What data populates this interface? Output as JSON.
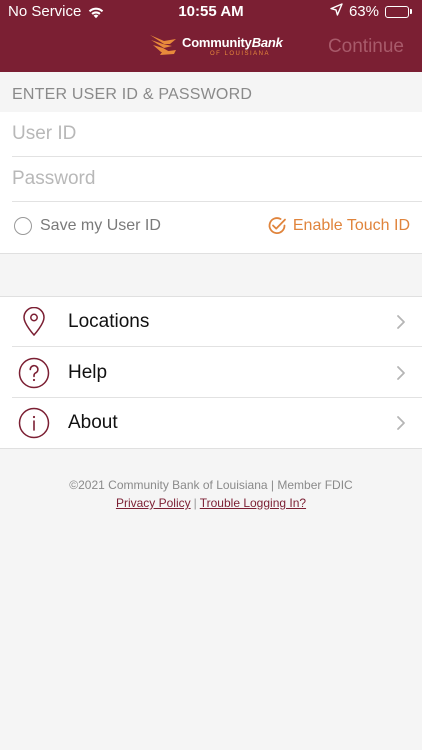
{
  "status_bar": {
    "carrier": "No Service",
    "time": "10:55 AM",
    "battery": "63%",
    "battery_level": 0.63
  },
  "header": {
    "logo": {
      "main_a": "Community",
      "main_b": "Bank",
      "sub": "OF LOUISIANA"
    },
    "continue_label": "Continue"
  },
  "login": {
    "section_label": "ENTER USER ID & PASSWORD",
    "userid_placeholder": "User ID",
    "password_placeholder": "Password",
    "save_userid_label": "Save my User ID",
    "touch_id_label": "Enable Touch ID"
  },
  "menu": {
    "items": [
      {
        "label": "Locations",
        "icon": "location-pin-icon"
      },
      {
        "label": "Help",
        "icon": "question-icon"
      },
      {
        "label": "About",
        "icon": "info-icon"
      }
    ]
  },
  "footer": {
    "copyright": "©2021 Community Bank of Louisiana | Member FDIC",
    "privacy_label": "Privacy Policy",
    "separator": "|",
    "trouble_label": "Trouble Logging In?"
  },
  "colors": {
    "brand": "#7b1f33",
    "accent": "#e0843c"
  }
}
